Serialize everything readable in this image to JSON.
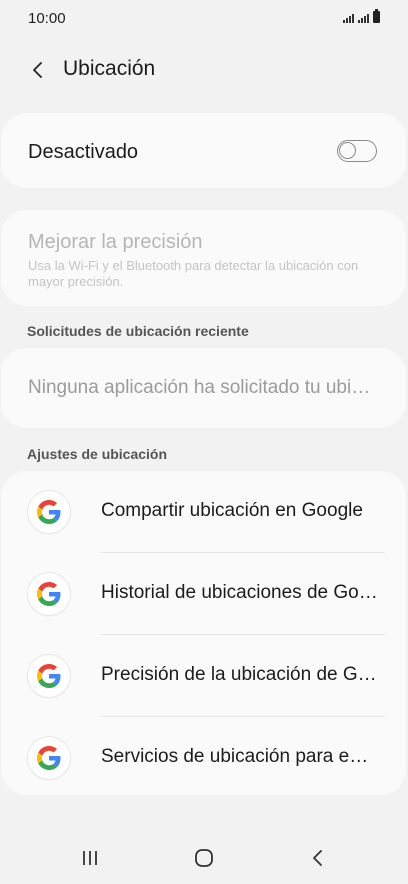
{
  "status_bar": {
    "time": "10:00"
  },
  "header": {
    "title": "Ubicación"
  },
  "location_toggle": {
    "label": "Desactivado",
    "state": "off"
  },
  "accuracy": {
    "title": "Mejorar la precisión",
    "description": "Usa la Wi-Fi y el Bluetooth para detectar la ubicación con mayor precisión."
  },
  "recent_requests": {
    "heading": "Solicitudes de ubicación reciente",
    "empty_text": "Ninguna aplicación ha solicitado tu ubicación recientemente"
  },
  "location_settings": {
    "heading": "Ajustes de ubicación",
    "items": [
      {
        "label": "Compartir ubicación en Google",
        "icon": "google-icon"
      },
      {
        "label": "Historial de ubicaciones de Google",
        "icon": "google-icon"
      },
      {
        "label": "Precisión de la ubicación de Google",
        "icon": "google-icon"
      },
      {
        "label": "Servicios de ubicación para emergencias",
        "icon": "google-icon"
      }
    ]
  },
  "navigation": {
    "recents": "recents-icon",
    "home": "home-icon",
    "back": "back-icon"
  },
  "colors": {
    "background": "#f2f2f2",
    "card": "#fafafa",
    "disabled_text": "#b6b6b6"
  }
}
